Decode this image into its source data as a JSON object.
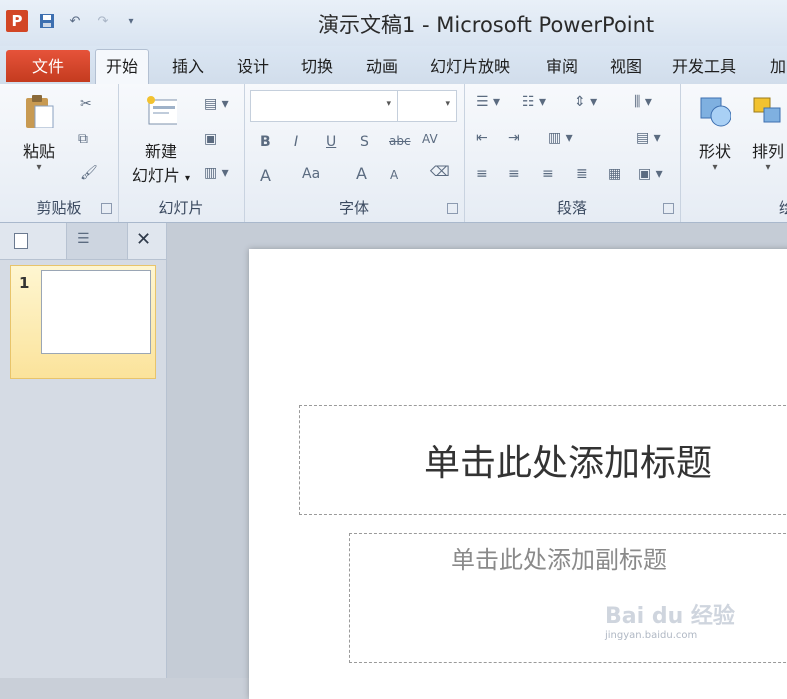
{
  "window": {
    "title": "演示文稿1 - Microsoft PowerPoint"
  },
  "qat": {
    "logo": "P"
  },
  "tabs": [
    {
      "label": "文件"
    },
    {
      "label": "开始"
    },
    {
      "label": "插入"
    },
    {
      "label": "设计"
    },
    {
      "label": "切换"
    },
    {
      "label": "动画"
    },
    {
      "label": "幻灯片放映"
    },
    {
      "label": "审阅"
    },
    {
      "label": "视图"
    },
    {
      "label": "开发工具"
    },
    {
      "label": "加"
    }
  ],
  "ribbon": {
    "clipboard": {
      "paste": "粘贴",
      "group": "剪贴板"
    },
    "slides": {
      "new_line1": "新建",
      "new_line2": "幻灯片",
      "group": "幻灯片"
    },
    "font": {
      "group": "字体",
      "bold": "B",
      "italic": "I",
      "underline": "U",
      "shadow": "S",
      "strike": "abc",
      "spacing": "AV",
      "color": "A",
      "case": "Aa",
      "grow": "A",
      "shrink": "A"
    },
    "paragraph": {
      "group": "段落"
    },
    "drawing": {
      "shape": "形状",
      "arrange": "排列",
      "partial": "绘"
    }
  },
  "pane": {
    "slide_number": "1",
    "close": "✕"
  },
  "slide": {
    "title_placeholder": "单击此处添加标题",
    "subtitle_placeholder": "单击此处添加副标题"
  },
  "watermark": {
    "brand": "Bai du 经验",
    "url": "jingyan.baidu.com"
  }
}
